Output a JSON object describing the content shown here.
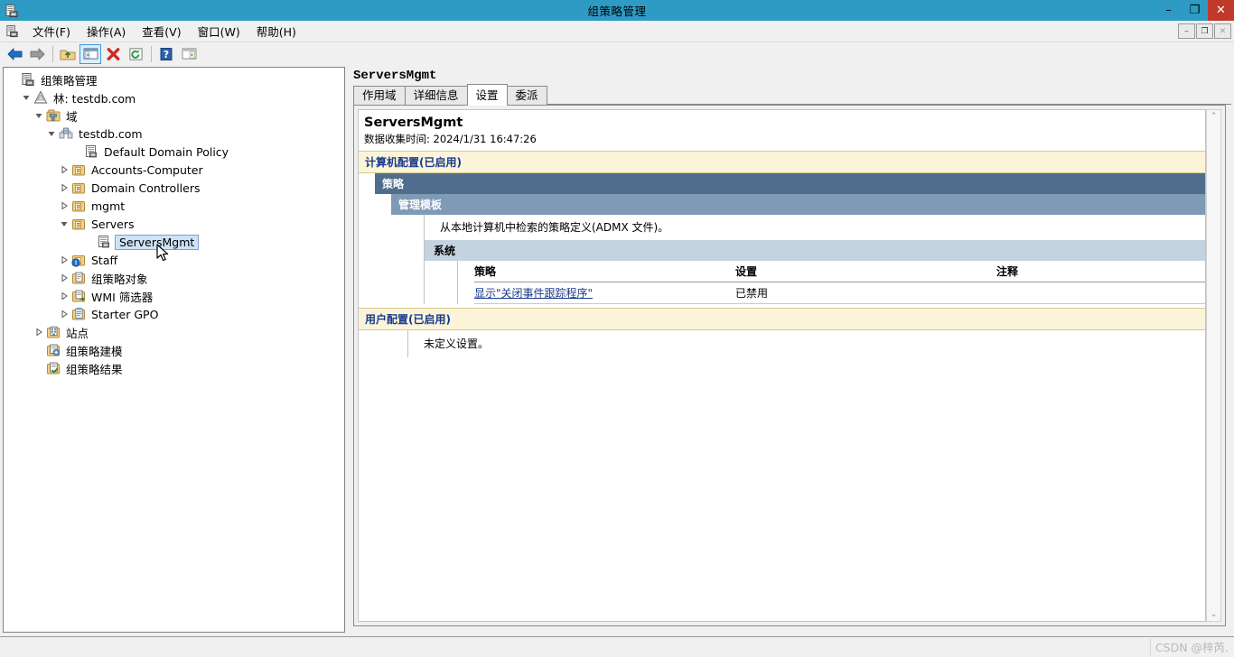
{
  "window": {
    "title": "组策略管理",
    "icon": "gpmc-icon",
    "buttons": {
      "minimize": "–",
      "restore": "❐",
      "close": "✕"
    }
  },
  "menu": {
    "icon": "gpmc-small-icon",
    "items": [
      {
        "label": "文件(F)",
        "name": "menu-file"
      },
      {
        "label": "操作(A)",
        "name": "menu-action"
      },
      {
        "label": "查看(V)",
        "name": "menu-view"
      },
      {
        "label": "窗口(W)",
        "name": "menu-window"
      },
      {
        "label": "帮助(H)",
        "name": "menu-help"
      }
    ],
    "mdi_buttons": {
      "minimize": "–",
      "restore": "❐",
      "close": "✕"
    }
  },
  "toolbar": {
    "items": [
      {
        "name": "back-icon",
        "title": "后退"
      },
      {
        "name": "forward-icon",
        "title": "前进"
      },
      {
        "name": "up-folder-icon",
        "title": "上移一级"
      },
      {
        "name": "show-hide-tree-icon",
        "title": "显示/隐藏控制台树",
        "selected": true
      },
      {
        "name": "delete-icon",
        "title": "删除"
      },
      {
        "name": "refresh-icon",
        "title": "刷新"
      },
      {
        "name": "help-icon",
        "title": "帮助"
      },
      {
        "name": "properties-icon",
        "title": "属性"
      }
    ]
  },
  "tree": {
    "nodes": [
      {
        "label": "组策略管理",
        "indent": 0,
        "glyph": "none",
        "icon": "gpmc-icon",
        "name": "tree-node-gpmc",
        "selected": false
      },
      {
        "label": "林: testdb.com",
        "indent": 1,
        "glyph": "expanded",
        "icon": "forest-icon",
        "name": "tree-node-forest",
        "selected": false
      },
      {
        "label": "域",
        "indent": 2,
        "glyph": "expanded",
        "icon": "domains-icon",
        "name": "tree-node-domains",
        "selected": false
      },
      {
        "label": "testdb.com",
        "indent": 3,
        "glyph": "expanded",
        "icon": "domain-icon",
        "name": "tree-node-domain-testdb",
        "selected": false
      },
      {
        "label": "Default Domain Policy",
        "indent": 5,
        "glyph": "none",
        "icon": "gpo-icon",
        "name": "tree-node-default-domain-policy",
        "selected": false
      },
      {
        "label": "Accounts-Computer",
        "indent": 4,
        "glyph": "collapsed",
        "icon": "ou-icon",
        "name": "tree-node-accounts-computer",
        "selected": false
      },
      {
        "label": "Domain Controllers",
        "indent": 4,
        "glyph": "collapsed",
        "icon": "ou-icon",
        "name": "tree-node-domain-controllers",
        "selected": false
      },
      {
        "label": "mgmt",
        "indent": 4,
        "glyph": "collapsed",
        "icon": "ou-icon",
        "name": "tree-node-mgmt",
        "selected": false
      },
      {
        "label": "Servers",
        "indent": 4,
        "glyph": "expanded",
        "icon": "ou-icon",
        "name": "tree-node-servers",
        "selected": false
      },
      {
        "label": "ServersMgmt",
        "indent": 6,
        "glyph": "none",
        "icon": "gpo-icon",
        "name": "tree-node-serversmgmt",
        "selected": true
      },
      {
        "label": "Staff",
        "indent": 4,
        "glyph": "collapsed",
        "icon": "ou-blocked-icon",
        "name": "tree-node-staff",
        "selected": false
      },
      {
        "label": "组策略对象",
        "indent": 4,
        "glyph": "collapsed",
        "icon": "gpo-container-icon",
        "name": "tree-node-gpo-container",
        "selected": false
      },
      {
        "label": "WMI 筛选器",
        "indent": 4,
        "glyph": "collapsed",
        "icon": "wmi-filter-icon",
        "name": "tree-node-wmi-filters",
        "selected": false
      },
      {
        "label": "Starter GPO",
        "indent": 4,
        "glyph": "collapsed",
        "icon": "starter-gpo-icon",
        "name": "tree-node-starter-gpo",
        "selected": false
      },
      {
        "label": "站点",
        "indent": 2,
        "glyph": "collapsed",
        "icon": "sites-icon",
        "name": "tree-node-sites",
        "selected": false
      },
      {
        "label": "组策略建模",
        "indent": 2,
        "glyph": "none",
        "icon": "modeling-icon",
        "name": "tree-node-modeling",
        "selected": false
      },
      {
        "label": "组策略结果",
        "indent": 2,
        "glyph": "none",
        "icon": "results-icon",
        "name": "tree-node-results",
        "selected": false
      }
    ]
  },
  "detail": {
    "header": "ServersMgmt",
    "tabs": [
      {
        "label": "作用域",
        "name": "tab-scope",
        "active": false
      },
      {
        "label": "详细信息",
        "name": "tab-details",
        "active": false
      },
      {
        "label": "设置",
        "name": "tab-settings",
        "active": true
      },
      {
        "label": "委派",
        "name": "tab-delegation",
        "active": false
      }
    ],
    "report": {
      "title": "ServersMgmt",
      "collected": "数据收集时间: 2024/1/31 16:47:26",
      "computer_config_band": "计算机配置(已启用)",
      "policies_band": "策略",
      "admin_templates_band": "管理模板",
      "admx_note": "从本地计算机中检索的策略定义(ADMX 文件)。",
      "system_band": "系统",
      "table": {
        "columns": [
          "策略",
          "设置",
          "注释"
        ],
        "rows": [
          {
            "policy": "显示\"关闭事件跟踪程序\"",
            "setting": "已禁用",
            "comment": ""
          }
        ]
      },
      "user_config_band": "用户配置(已启用)",
      "user_config_note": "未定义设置。"
    },
    "scrollbar": {
      "up": "⌃",
      "down": "⌄"
    }
  },
  "watermark": "CSDN @梓芮.",
  "colors": {
    "titlebar": "#2e9bc4",
    "close_button": "#c0392b",
    "band_config": "#fbf4d8",
    "band_config_text": "#1a3a8f",
    "band_level1": "#4f6d8c",
    "band_level2": "#7e9ab5",
    "band_level3": "#c5d2df",
    "selection": "#cde3f7",
    "link": "#1a3a8f"
  }
}
